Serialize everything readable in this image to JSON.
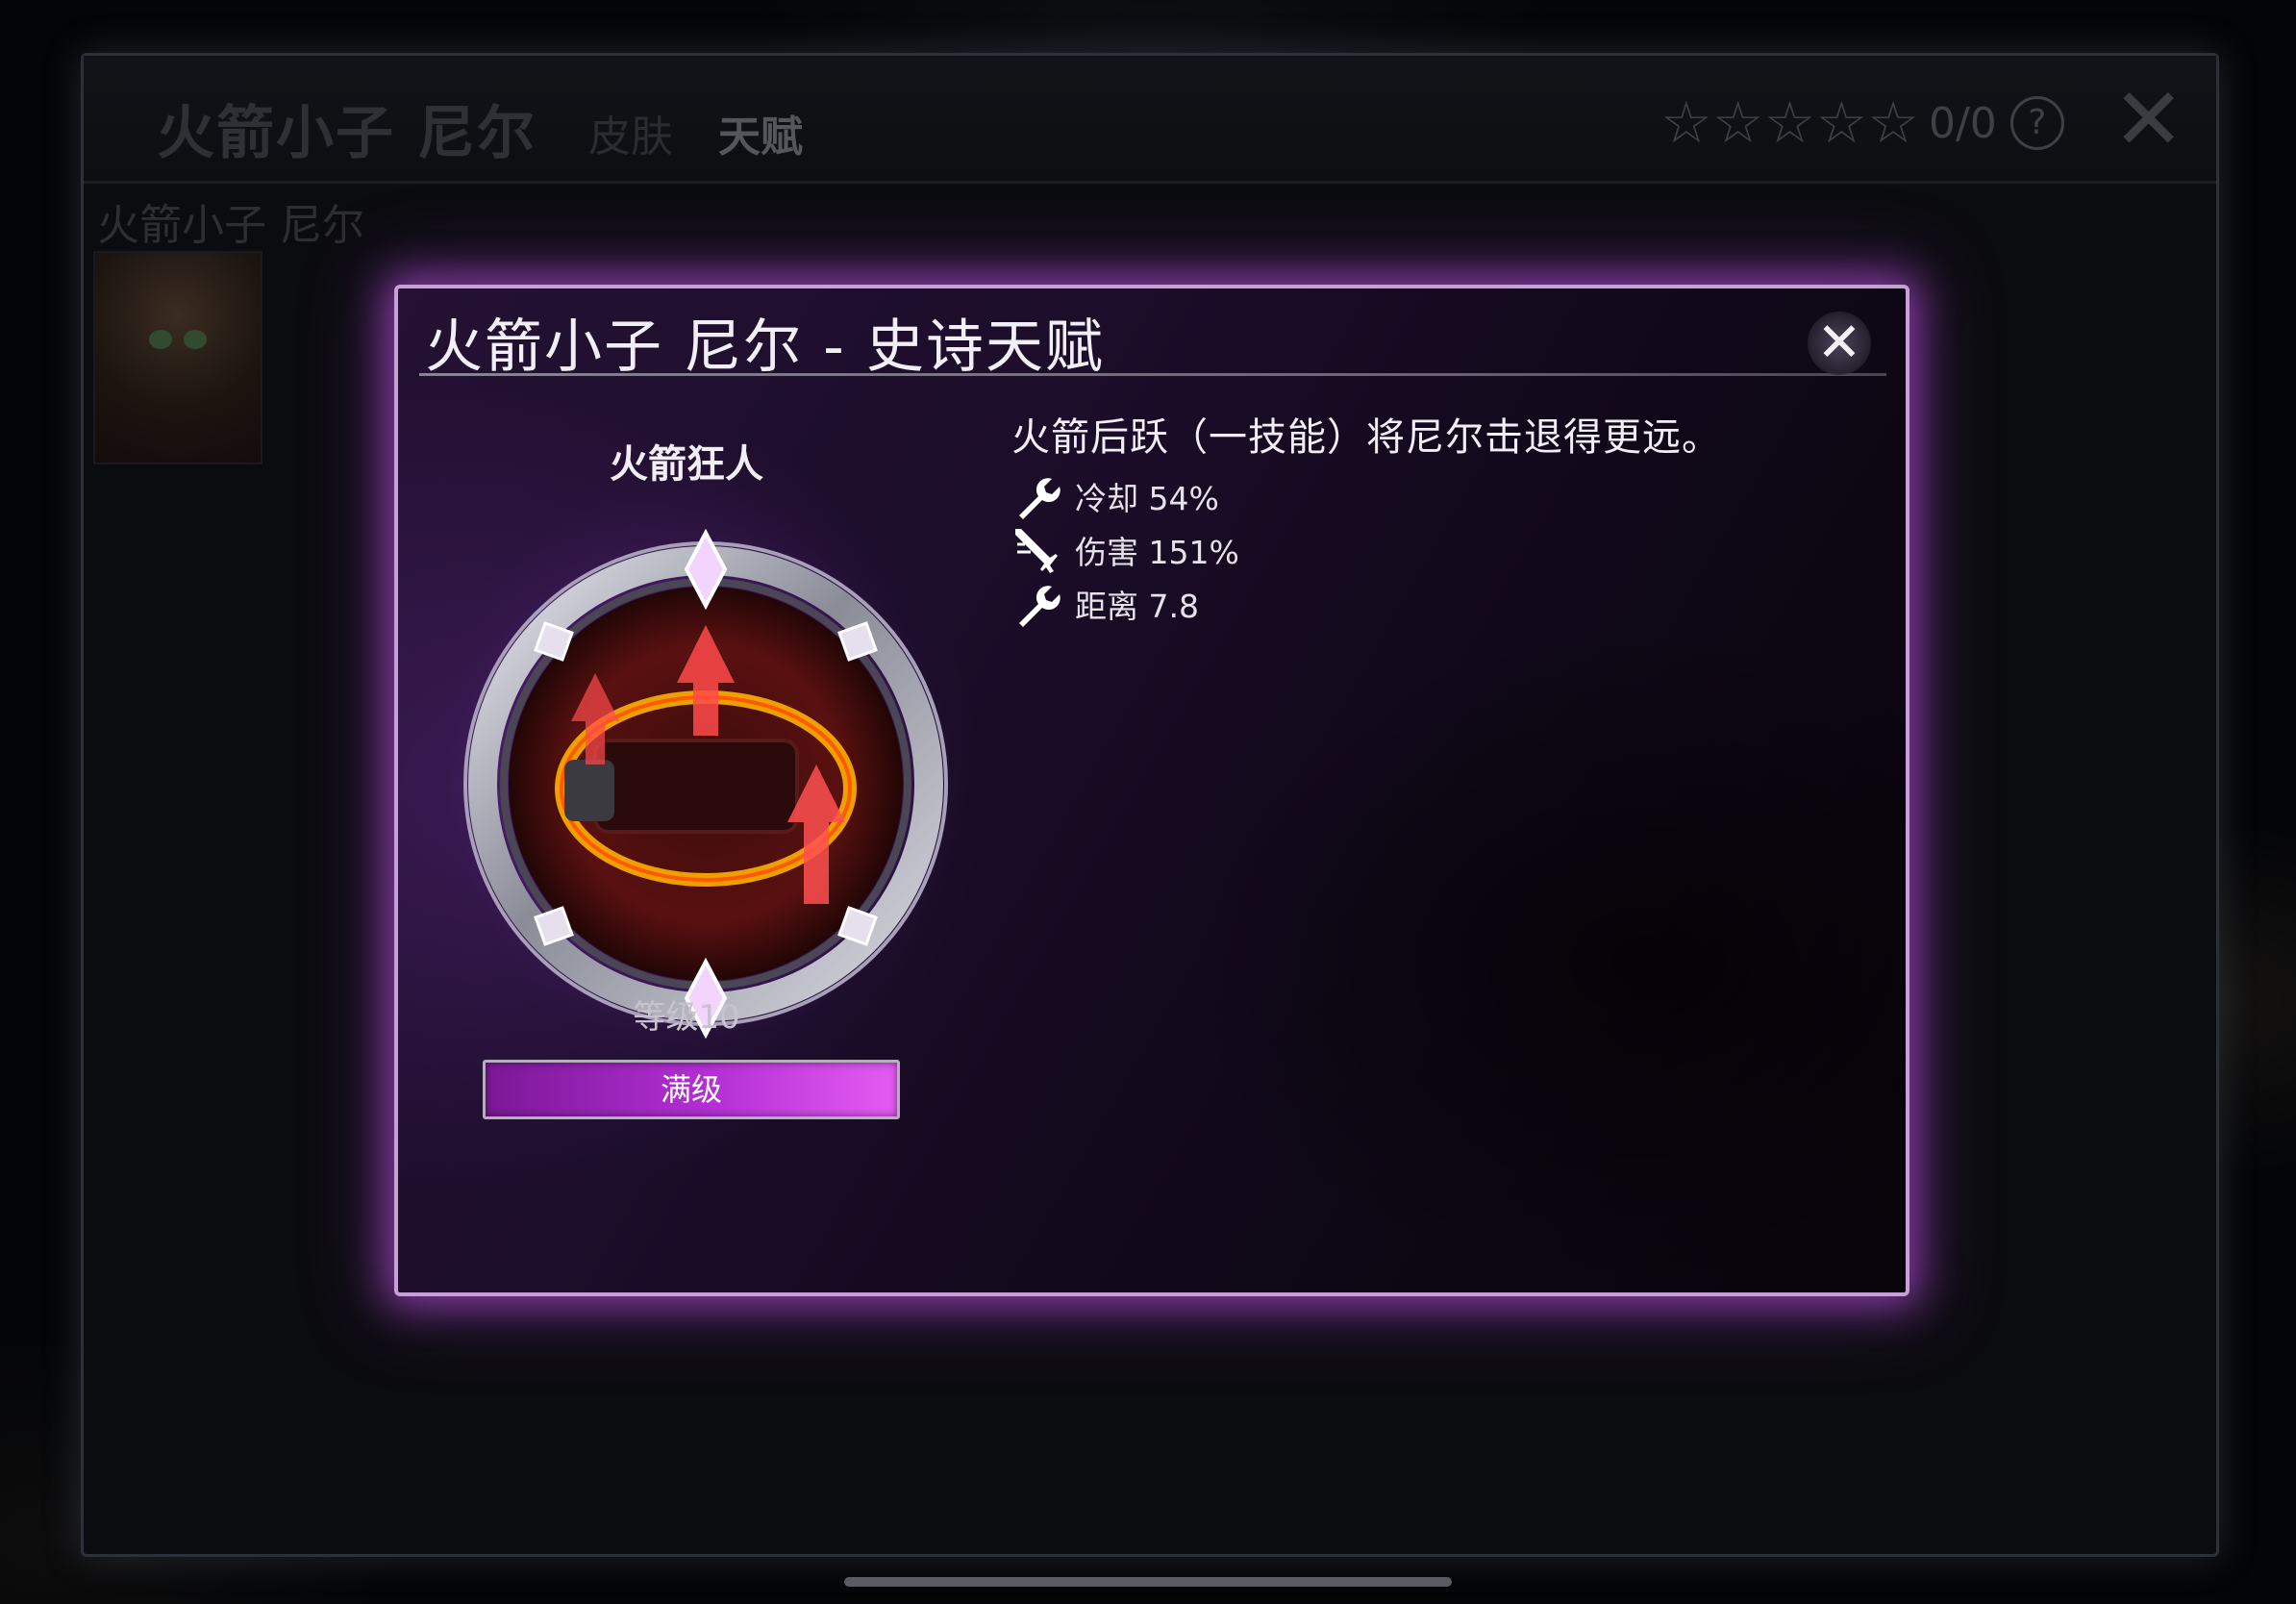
{
  "outer": {
    "title": "火箭小子 尼尔",
    "tabs": [
      {
        "label": "皮肤"
      },
      {
        "label": "天赋"
      }
    ],
    "rating": {
      "stars": "☆☆☆☆☆",
      "count": "0/0",
      "help": "?"
    },
    "close": "✕",
    "subtitle": "火箭小子 尼尔"
  },
  "modal": {
    "title": "火箭小子 尼尔 - 史诗天赋",
    "close": "✕",
    "talent": {
      "name": "火箭狂人",
      "level_label": "等级10",
      "max_label": "满级",
      "progress_fraction": 1.0
    },
    "description": "火箭后跃（一技能）将尼尔击退得更远。",
    "stats": [
      {
        "icon": "wrench-icon",
        "label": "冷却 54%"
      },
      {
        "icon": "sword-icon",
        "label": "伤害 151%"
      },
      {
        "icon": "wrench-icon",
        "label": "距离 7.8"
      }
    ]
  },
  "colors": {
    "modal_border": "#c8a0d8",
    "glow": "#c85af0",
    "bar_fill": "#b42fd4"
  }
}
